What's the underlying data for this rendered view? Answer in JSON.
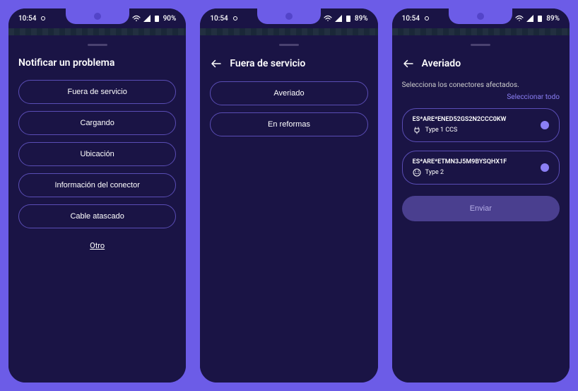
{
  "status": {
    "time": "10:54",
    "batteries": [
      "90%",
      "89%",
      "89%"
    ]
  },
  "screen1": {
    "title": "Notificar un problema",
    "options": [
      "Fuera de servicio",
      "Cargando",
      "Ubicación",
      "Información del conector",
      "Cable atascado"
    ],
    "other": "Otro"
  },
  "screen2": {
    "title": "Fuera de servicio",
    "options": [
      "Averiado",
      "En reformas"
    ]
  },
  "screen3": {
    "title": "Averiado",
    "subtitle": "Selecciona los conectores afectados.",
    "select_all": "Seleccionar todo",
    "connectors": [
      {
        "id": "ES*ARE*ENED52GS2N2CCC0KW",
        "type": "Type 1 CCS",
        "icon": "plug"
      },
      {
        "id": "ES*ARE*ETMN3J5M9BYSQHX1F",
        "type": "Type 2",
        "icon": "type2"
      }
    ],
    "submit": "Enviar"
  }
}
